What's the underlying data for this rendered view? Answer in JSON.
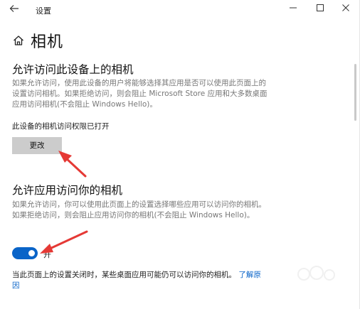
{
  "window": {
    "app_title": "设置",
    "back_icon": "back-arrow-icon",
    "minimize_icon": "minimize-icon",
    "maximize_icon": "maximize-icon",
    "close_icon": "close-icon"
  },
  "header": {
    "home_icon": "home-icon",
    "title": "相机"
  },
  "device_section": {
    "title": "允许访问此设备上的相机",
    "description": "如果允许访问，使用此设备的用户将能够选择其应用是否可以使用此页面上的设置访问相机。如果拒绝访问，则会阻止 Microsoft Store 应用和大多数桌面应用访问相机(不会阻止 Windows Hello)。",
    "status": "此设备的相机访问权限已打开",
    "change_button": "更改"
  },
  "app_section": {
    "title": "允许应用访问你的相机",
    "description": "如果允许访问，你可以使用此页面上的设置选择哪些应用可以访问你的相机。如果拒绝访问，则会阻止应用访问你的相机(不会阻止 Windows Hello)。",
    "toggle_state": true,
    "toggle_label": "开"
  },
  "note": {
    "text": "当此页面上的设置关闭时，某些桌面应用可能仍可以访问你的相机。",
    "link_text": "了解原因"
  },
  "colors": {
    "accent": "#0a64c8",
    "annotation_arrow": "#e53935",
    "button_bg": "#cccccc"
  }
}
